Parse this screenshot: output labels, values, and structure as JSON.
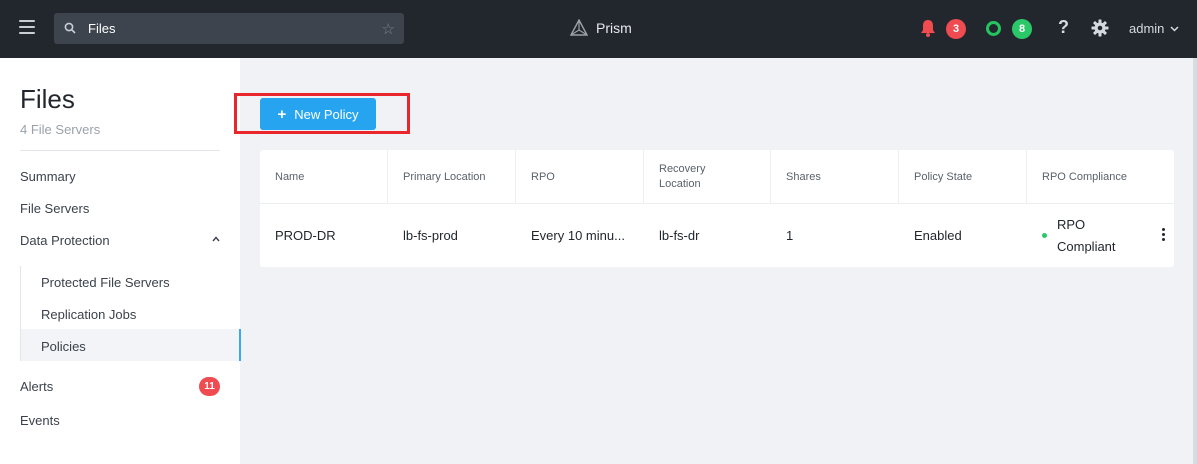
{
  "topbar": {
    "search_value": "Files",
    "brand": "Prism",
    "alerts_count": "3",
    "health_count": "8",
    "help_label": "?",
    "user": "admin",
    "colors": {
      "bar": "#22272e",
      "alert": "#ef4b50",
      "health": "#2bc86a"
    }
  },
  "sidebar": {
    "title": "Files",
    "subtitle": "4 File Servers",
    "items": {
      "summary": "Summary",
      "file_servers": "File Servers",
      "data_protection": "Data Protection",
      "protected_file_servers": "Protected File Servers",
      "replication_jobs": "Replication Jobs",
      "policies": "Policies",
      "alerts": "Alerts",
      "alerts_badge": "11",
      "events": "Events"
    },
    "active_item": "Policies"
  },
  "main": {
    "new_button_label": "New Policy",
    "new_button_icon": "plus-icon",
    "table": {
      "columns": [
        "Name",
        "Primary Location",
        "RPO",
        "Recovery Location",
        "Shares",
        "Policy State",
        "RPO Compliance"
      ],
      "rows": [
        {
          "name": "PROD-DR",
          "primary_location": "lb-fs-prod",
          "rpo": "Every 10 minu...",
          "recovery_location": "lb-fs-dr",
          "shares": "1",
          "policy_state": "Enabled",
          "rpo_compliance": "RPO Compliant"
        }
      ]
    }
  },
  "accent_color": "#27a4f0"
}
